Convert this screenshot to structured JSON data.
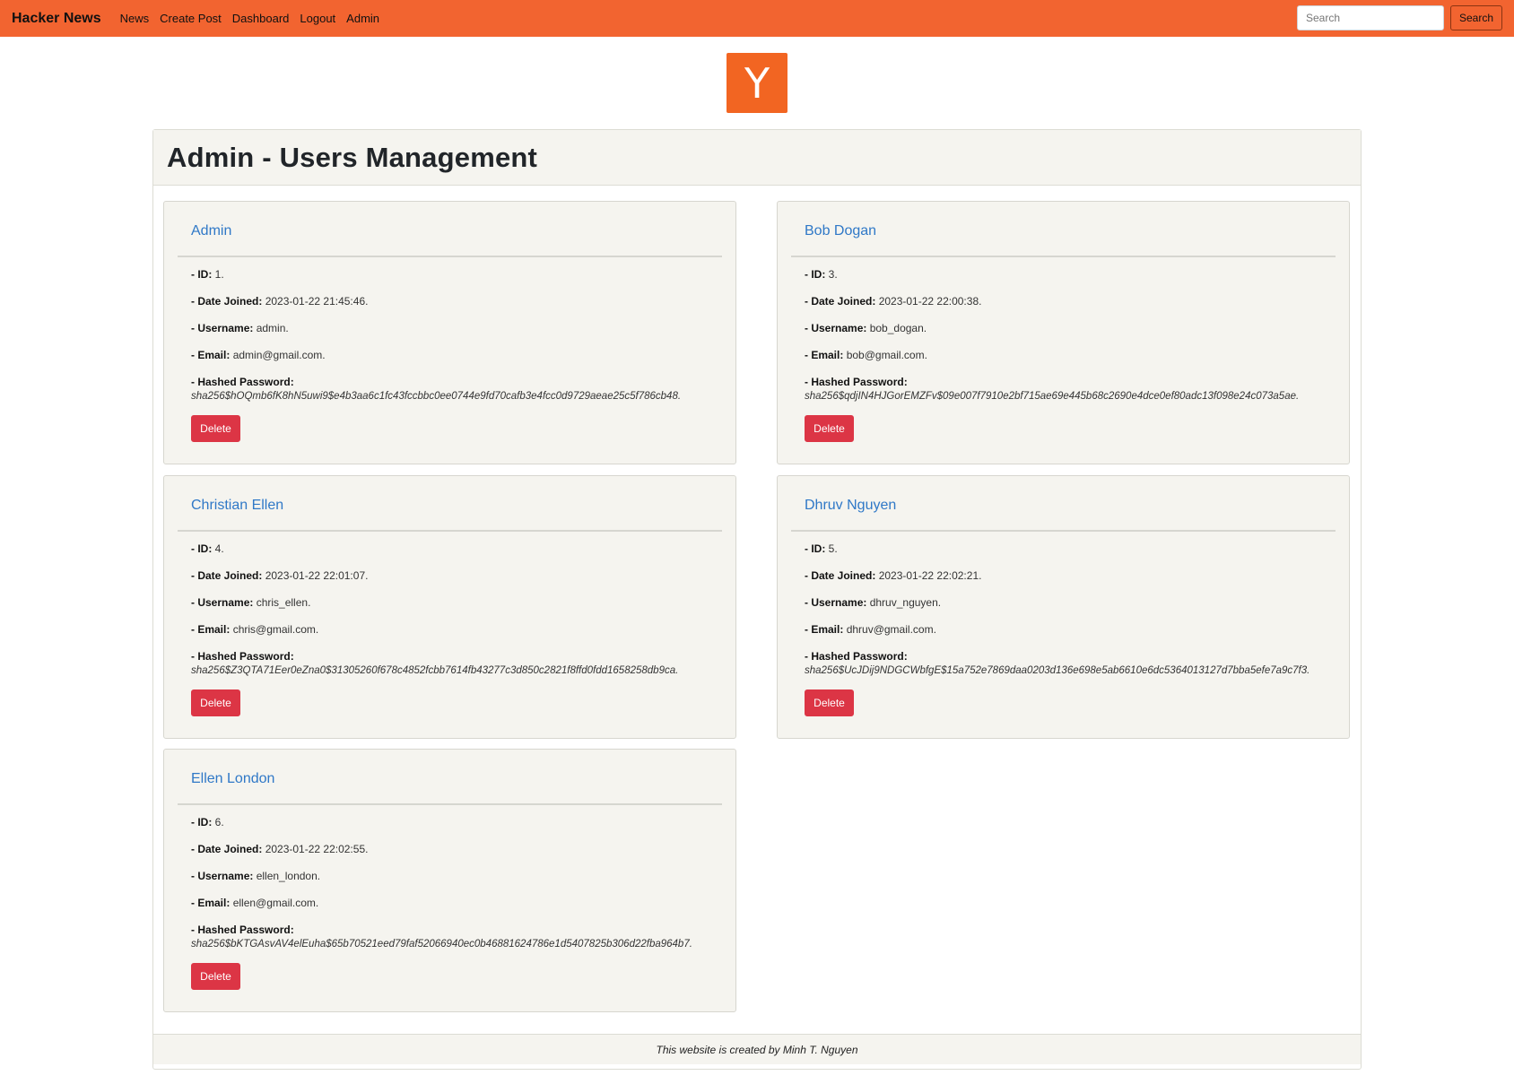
{
  "nav": {
    "brand": "Hacker News",
    "links": [
      "News",
      "Create Post",
      "Dashboard",
      "Logout",
      "Admin"
    ],
    "search_placeholder": "Search",
    "search_button": "Search"
  },
  "logo": {
    "letter": "Y"
  },
  "page": {
    "title": "Admin - Users Management"
  },
  "labels": {
    "id": "- ID:",
    "date_joined": "- Date Joined:",
    "username": "- Username:",
    "email": "- Email:",
    "hashed_password": "- Hashed Password:",
    "delete": "Delete"
  },
  "users": [
    {
      "name": "Admin",
      "id": "1.",
      "date_joined": "2023-01-22 21:45:46.",
      "username": "admin.",
      "email": "admin@gmail.com.",
      "hashed_password": "sha256$hOQmb6fK8hN5uwi9$e4b3aa6c1fc43fccbbc0ee0744e9fd70cafb3e4fcc0d9729aeae25c5f786cb48."
    },
    {
      "name": "Bob Dogan",
      "id": "3.",
      "date_joined": "2023-01-22 22:00:38.",
      "username": "bob_dogan.",
      "email": "bob@gmail.com.",
      "hashed_password": "sha256$qdjIN4HJGorEMZFv$09e007f7910e2bf715ae69e445b68c2690e4dce0ef80adc13f098e24c073a5ae."
    },
    {
      "name": "Christian Ellen",
      "id": "4.",
      "date_joined": "2023-01-22 22:01:07.",
      "username": "chris_ellen.",
      "email": "chris@gmail.com.",
      "hashed_password": "sha256$Z3QTA71Eer0eZna0$31305260f678c4852fcbb7614fb43277c3d850c2821f8ffd0fdd1658258db9ca."
    },
    {
      "name": "Dhruv Nguyen",
      "id": "5.",
      "date_joined": "2023-01-22 22:02:21.",
      "username": "dhruv_nguyen.",
      "email": "dhruv@gmail.com.",
      "hashed_password": "sha256$UcJDij9NDGCWbfgE$15a752e7869daa0203d136e698e5ab6610e6dc5364013127d7bba5efe7a9c7f3."
    },
    {
      "name": "Ellen London",
      "id": "6.",
      "date_joined": "2023-01-22 22:02:55.",
      "username": "ellen_london.",
      "email": "ellen@gmail.com.",
      "hashed_password": "sha256$bKTGAsvAV4elEuha$65b70521eed79faf52066940ec0b46881624786e1d5407825b306d22fba964b7."
    }
  ],
  "footer": {
    "text": "This website is created by Minh T. Nguyen"
  },
  "colors": {
    "navbar": "#f26430",
    "logo": "#f26522",
    "card_bg": "#f5f4ef",
    "link": "#2f78c7",
    "danger": "#dc3545"
  }
}
